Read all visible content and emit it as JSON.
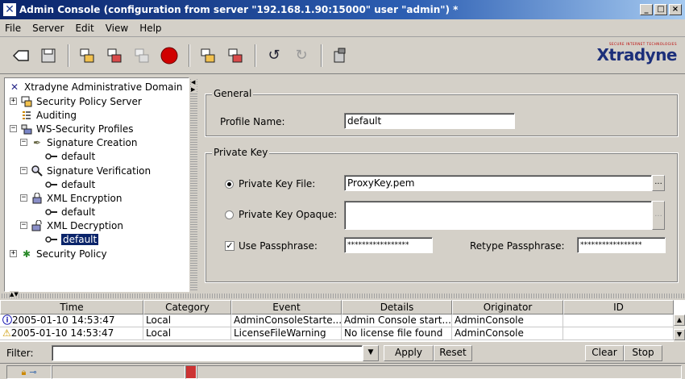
{
  "window": {
    "title": "Admin Console (configuration from server \"192.168.1.90:15000\" user \"admin\") *",
    "minimize": "_",
    "maximize": "□",
    "close": "×"
  },
  "menu": [
    "File",
    "Server",
    "Edit",
    "View",
    "Help"
  ],
  "toolbar": {
    "icons": [
      "back-icon",
      "save-icon",
      "connect-server-icon",
      "copy-server-icon",
      "disabled-server-icon",
      "stop-icon",
      "deploy-icon",
      "undeploy-icon",
      "undo-icon",
      "redo-icon",
      "tool-icon"
    ],
    "logo": "Xtradyne",
    "logo_tagline": "SECURE INTERNET TECHNOLOGIES"
  },
  "tree": {
    "root": "Xtradyne Administrative Domain",
    "items": [
      {
        "label": "Security Policy Server"
      },
      {
        "label": "Auditing"
      },
      {
        "label": "WS-Security Profiles"
      },
      {
        "label": "Signature Creation"
      },
      {
        "label": "default"
      },
      {
        "label": "Signature Verification"
      },
      {
        "label": "default"
      },
      {
        "label": "XML Encryption"
      },
      {
        "label": "default"
      },
      {
        "label": "XML Decryption"
      },
      {
        "label": "default"
      },
      {
        "label": "Security Policy"
      }
    ]
  },
  "general": {
    "group_title": "General",
    "profile_name_label": "Profile Name:",
    "profile_name_value": "default"
  },
  "private_key": {
    "group_title": "Private Key",
    "file_label": "Private Key File:",
    "file_value": "ProxyKey.pem",
    "opaque_label": "Private Key Opaque:",
    "opaque_value": "",
    "use_pass_label": "Use Passphrase:",
    "pass_value": "*****************",
    "retype_label": "Retype Passphrase:",
    "retype_value": "*****************",
    "ellipsis": "..."
  },
  "log": {
    "columns": [
      "Time",
      "Category",
      "Event",
      "Details",
      "Originator",
      "ID"
    ],
    "rows": [
      {
        "time": "2005-01-10 14:53:47",
        "category": "Local",
        "event": "AdminConsoleStarte...",
        "details": "Admin Console start...",
        "originator": "AdminConsole",
        "id": ""
      },
      {
        "time": "2005-01-10 14:53:47",
        "category": "Local",
        "event": "LicenseFileWarning",
        "details": "No license file found",
        "originator": "AdminConsole",
        "id": ""
      }
    ]
  },
  "filter": {
    "label": "Filter:",
    "value": "",
    "apply": "Apply",
    "reset": "Reset",
    "clear": "Clear",
    "stop": "Stop"
  }
}
